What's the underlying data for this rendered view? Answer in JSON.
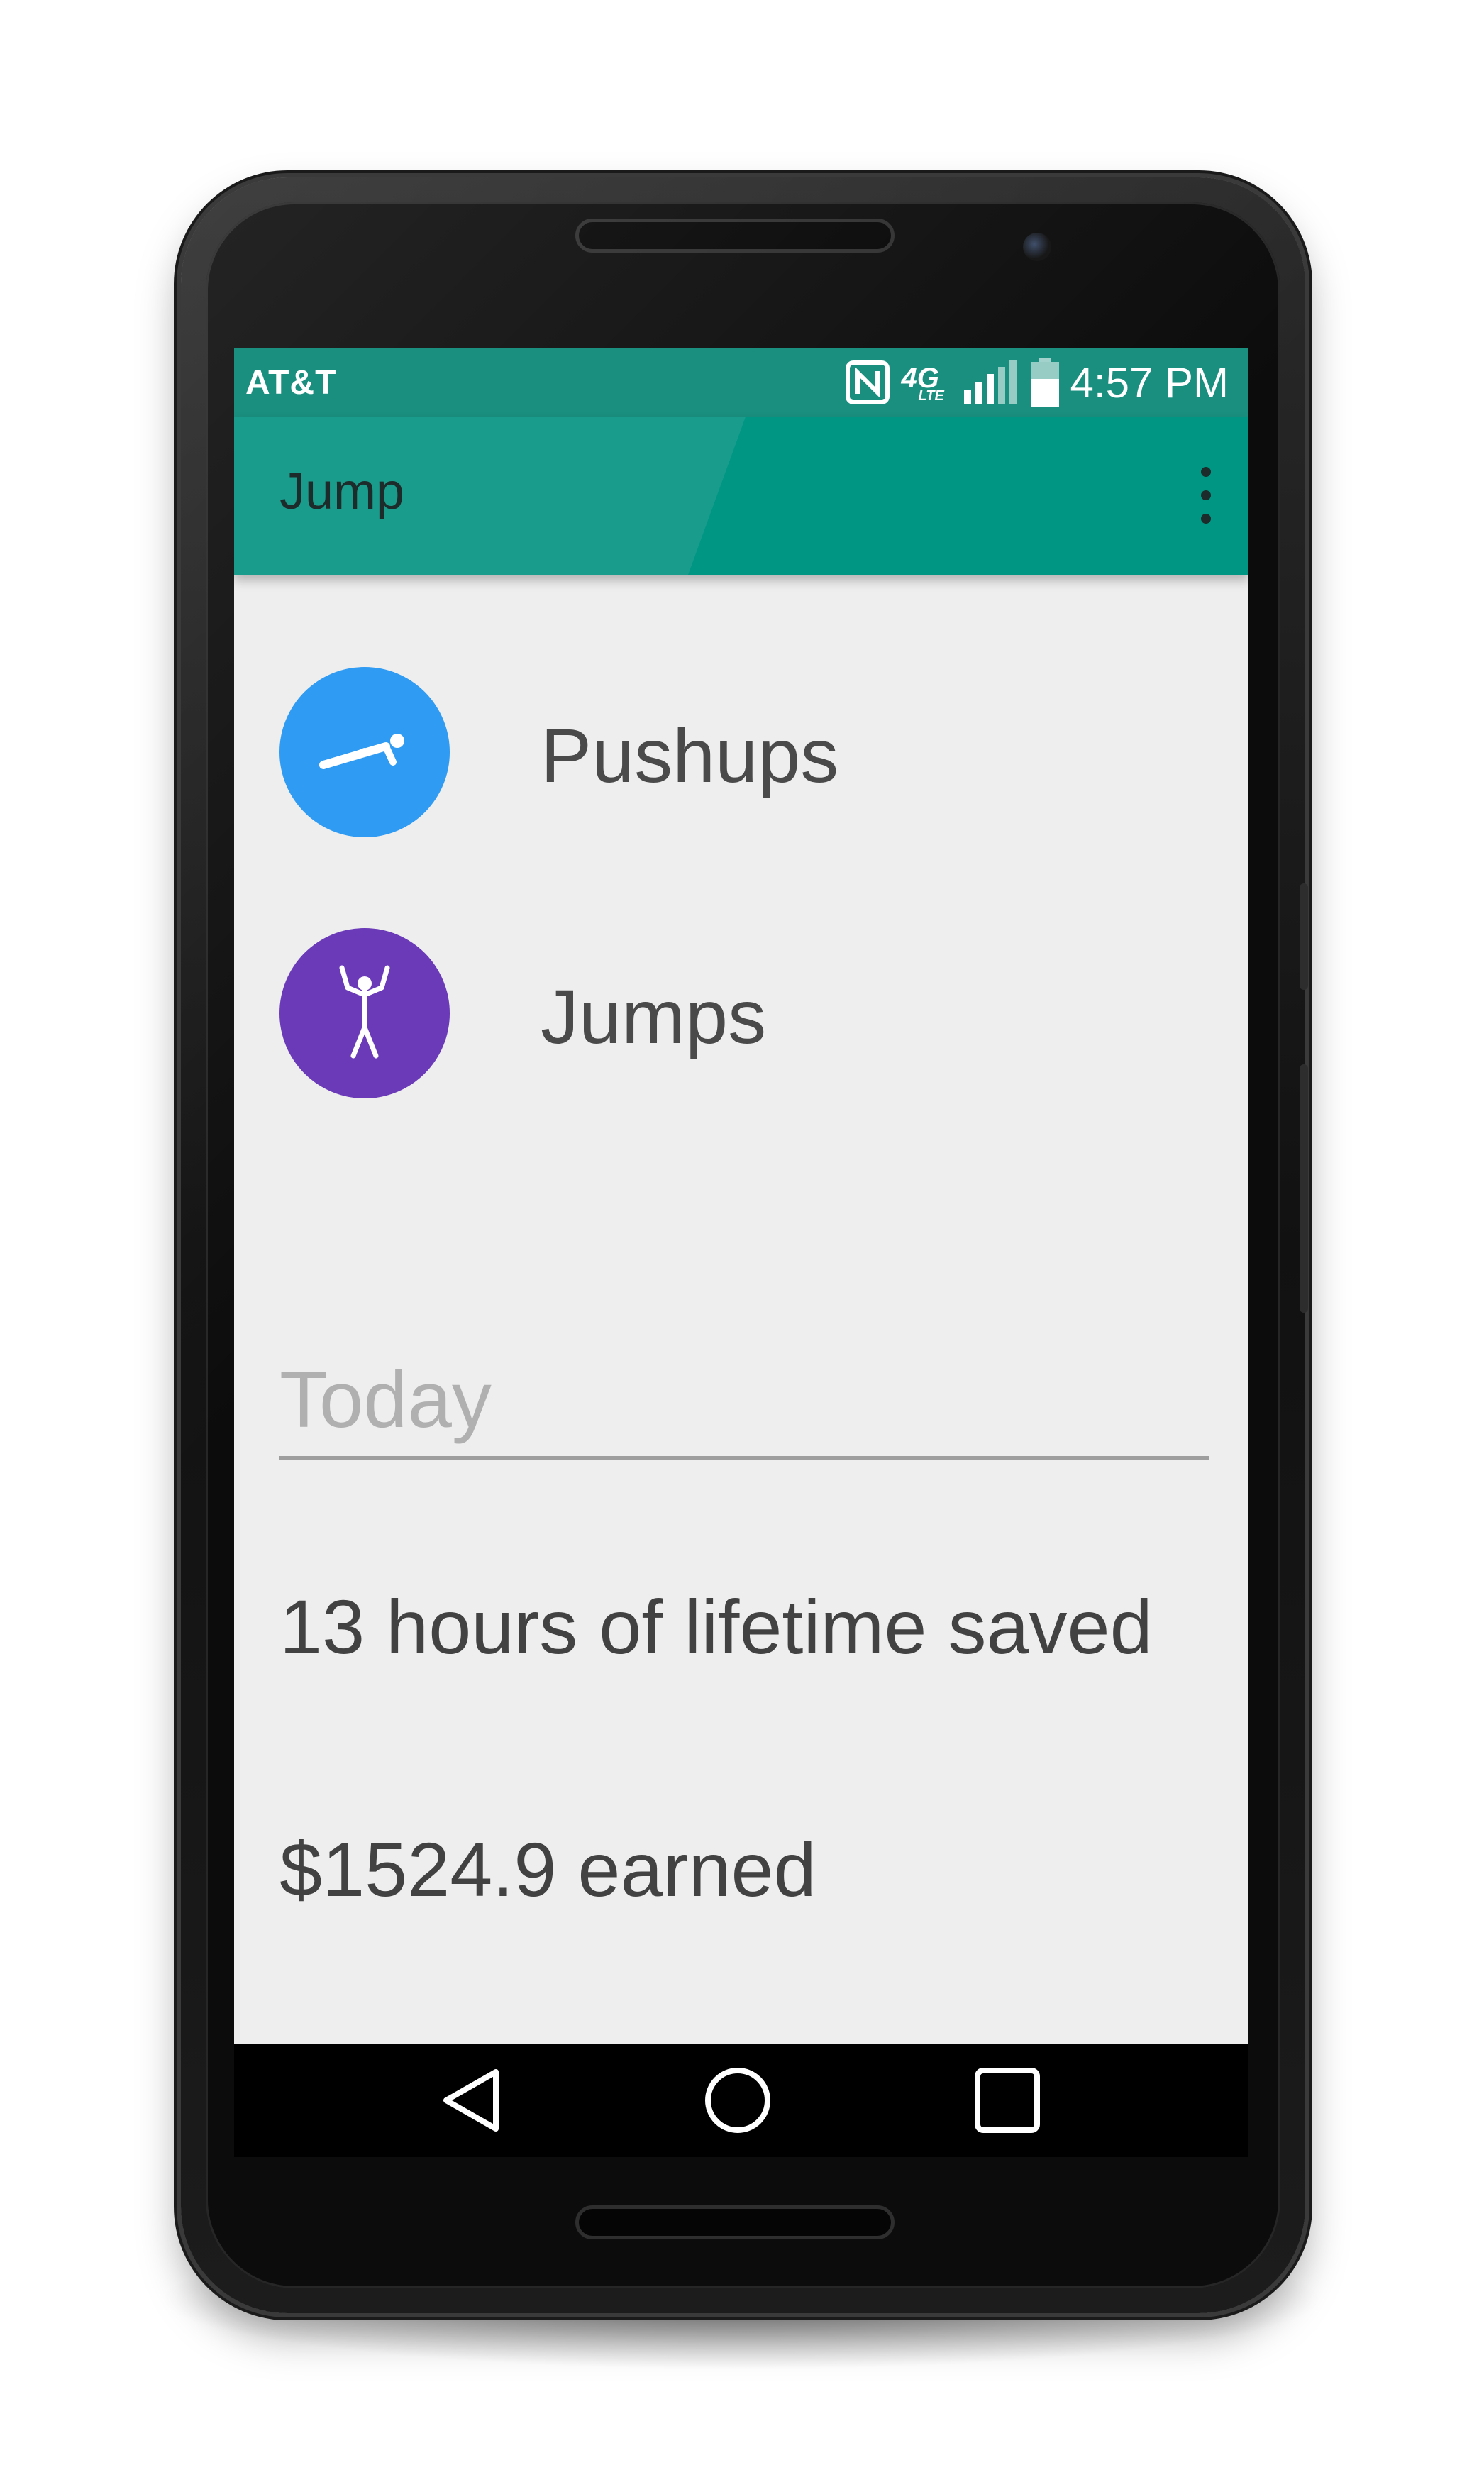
{
  "status_bar": {
    "carrier": "AT&T",
    "network": "4G",
    "network_sub": "LTE",
    "time": "4:57 PM",
    "icons": [
      "nfc-icon",
      "lte-icon",
      "signal-icon",
      "battery-icon"
    ]
  },
  "app_bar": {
    "title": "Jump",
    "menu_icon": "overflow-menu-icon"
  },
  "exercises": [
    {
      "label": "Pushups",
      "icon": "pushup-icon",
      "color": "#2f9bf2"
    },
    {
      "label": "Jumps",
      "icon": "jumping-jack-icon",
      "color": "#6a3ab8"
    }
  ],
  "today": {
    "heading": "Today",
    "lifetime_saved": "13 hours of lifetime saved",
    "earned": "$1524.9 earned"
  },
  "nav": {
    "icons": [
      "back-icon",
      "home-icon",
      "recents-icon"
    ]
  },
  "colors": {
    "status_bar": "#1a8f7f",
    "app_bar": "#1a9c8c",
    "background": "#eeeeee"
  }
}
